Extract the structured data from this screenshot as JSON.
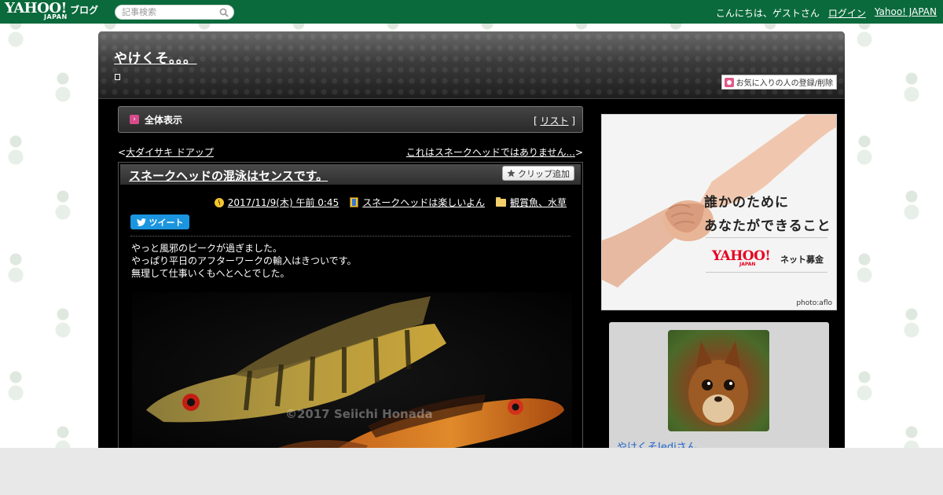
{
  "topbar": {
    "logo_text": "YAHOO!",
    "logo_sub": "JAPAN",
    "logo_blog": "ブログ",
    "search_placeholder": "記事検索",
    "greeting": "こんにちは、ゲストさん",
    "login_link": "ログイン",
    "yahoo_link": "Yahoo! JAPAN"
  },
  "blog": {
    "title": "やけくそ。。。",
    "favorite_button": "お気に入りの人の登録/削除"
  },
  "view_bar": {
    "title": "全体表示",
    "list_open": "[",
    "list_link": "リスト",
    "list_close": "]"
  },
  "nav": {
    "prev_prefix": "<",
    "prev_link": "大ダイサキ ドアップ",
    "next_link": "これはスネークヘッドではありません...",
    "next_suffix": ">"
  },
  "article": {
    "title": "スネークヘッドの混泳はセンスです。",
    "clip_button": "クリップ追加",
    "date": "2017/11/9(木) 午前 0:45",
    "category": "スネークヘッドは楽しいよん",
    "tag": "観賞魚、水草",
    "tweet_button": "ツイート",
    "body": [
      "やっと風邪のピークが過ぎました。",
      "やっぱり平日のアフターワークの輸入はきついです。",
      "無理して仕事いくもへとへとでした。"
    ],
    "photo_credit": "©2017 Seiichi Honada"
  },
  "ad": {
    "line1": "誰かのために",
    "line2": "あなたができること",
    "logo": "YAHOO!",
    "logo_sub": "JAPAN",
    "sub_label": "ネット募金",
    "photo_credit": "photo:aflo"
  },
  "profile": {
    "name": "やけくそJediさん"
  },
  "colors": {
    "topbar": "#0b6a3c",
    "accent_pink": "#d84a8b",
    "tweet_blue": "#1b95e0",
    "ad_red": "#e8001f",
    "profile_link": "#2266cc"
  }
}
